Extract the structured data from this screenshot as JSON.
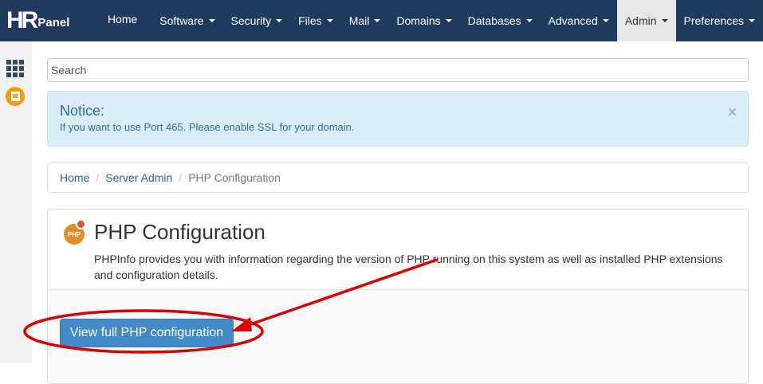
{
  "brand": {
    "logo_main": "HR",
    "logo_sub": "Panel"
  },
  "nav": {
    "items": [
      {
        "label": "Home",
        "dropdown": false
      },
      {
        "label": "Software",
        "dropdown": true
      },
      {
        "label": "Security",
        "dropdown": true
      },
      {
        "label": "Files",
        "dropdown": true
      },
      {
        "label": "Mail",
        "dropdown": true
      },
      {
        "label": "Domains",
        "dropdown": true
      },
      {
        "label": "Databases",
        "dropdown": true
      },
      {
        "label": "Advanced",
        "dropdown": true
      },
      {
        "label": "Admin",
        "dropdown": true,
        "active": true
      },
      {
        "label": "Preferences",
        "dropdown": true
      }
    ]
  },
  "sidebar": {
    "icons": [
      "apps-grid-icon",
      "file-manager-icon"
    ]
  },
  "search": {
    "placeholder": "Search"
  },
  "notice": {
    "title": "Notice:",
    "message": "If you want to use Port 465. Please enable SSL for your domain.",
    "close": "×"
  },
  "breadcrumb": {
    "items": [
      "Home",
      "Server Admin"
    ],
    "separator": "/",
    "active": "PHP Configuration"
  },
  "card": {
    "title": "PHP Configuration",
    "icon_text": "PHP",
    "description": "PHPInfo provides you with information regarding the version of PHP running on this system as well as installed PHP extensions and configuration details.",
    "button_label": "View full PHP configuration"
  },
  "colors": {
    "navbar": "#1f3a5f",
    "accent": "#428bca",
    "annotation": "#e00000"
  }
}
